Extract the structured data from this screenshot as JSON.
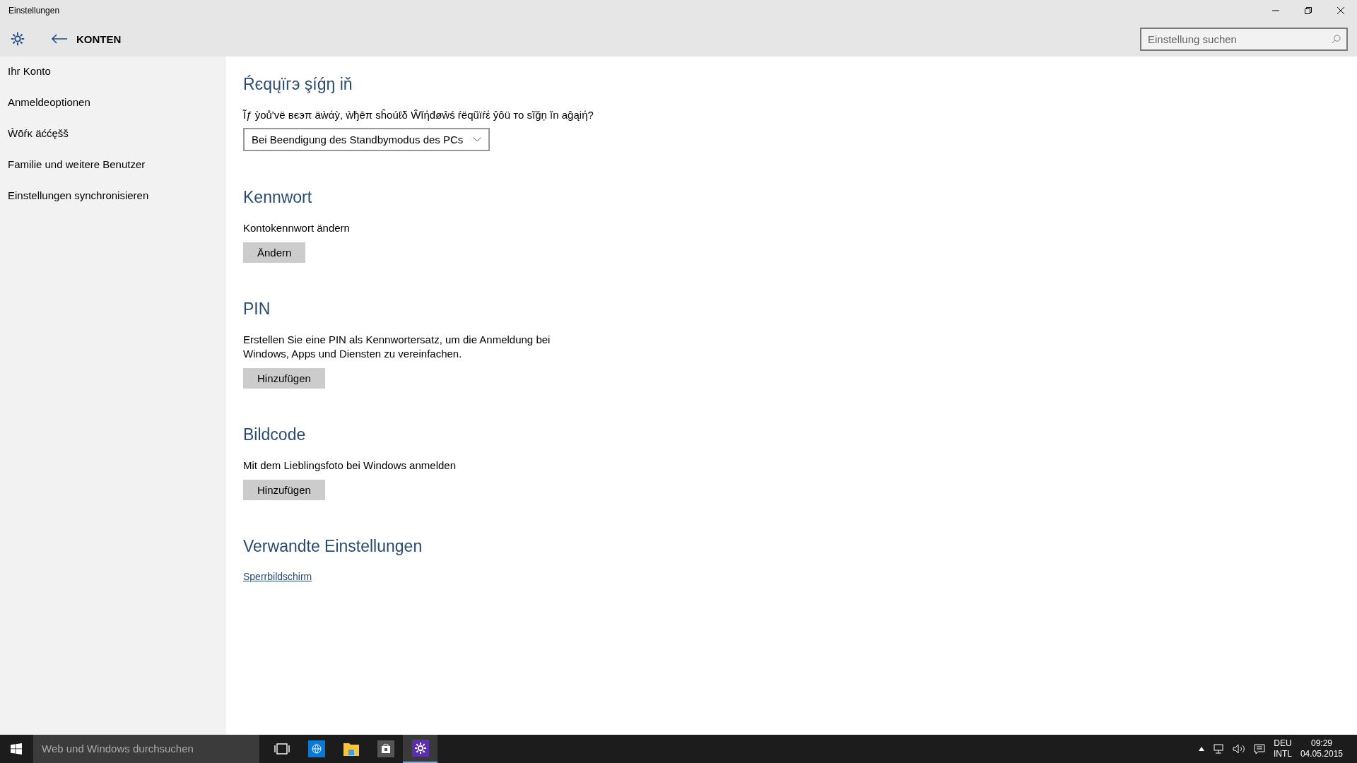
{
  "window": {
    "title": "Einstellungen"
  },
  "header": {
    "title": "KONTEN"
  },
  "search": {
    "placeholder": "Einstellung suchen"
  },
  "sidebar": {
    "items": [
      "Ihr Konto",
      "Anmeldeoptionen",
      "Ẁōŕκ äććęšš",
      "Familie und weitere Benutzer",
      "Einstellungen synchronisieren"
    ]
  },
  "sections": [
    {
      "heading": "Ŕєqųïгэ şíǵŋ iň",
      "kind": "dropdown",
      "text": "Ĩƒ ỳoů'vë вєэπ äẁάỳ, ẁђēπ sĥoúℓδ Ŵĭήđøŵś ŕëqũïŕέ ŷôü тο sĩğņ ĭn aĝąiή?",
      "value": "Bei Beendigung des Standbymodus des PCs"
    },
    {
      "heading": "Kennwort",
      "kind": "button",
      "text": "Kontokennwort ändern",
      "button": "Ändern"
    },
    {
      "heading": "PIN",
      "kind": "button",
      "text": "Erstellen Sie eine PIN als Kennwortersatz, um die Anmeldung bei Windows, Apps und Diensten zu vereinfachen.",
      "button": "Hinzufügen"
    },
    {
      "heading": "Bildcode",
      "kind": "button",
      "text": "Mit dem Lieblingsfoto bei Windows anmelden",
      "button": "Hinzufügen"
    },
    {
      "heading": "Verwandte Einstellungen",
      "kind": "link",
      "link": "Sperrbildschirm"
    }
  ],
  "taskbar": {
    "search_placeholder": "Web und Windows durchsuchen",
    "apps": [
      {
        "kind": "taskview",
        "active": false
      },
      {
        "kind": "browser",
        "active": false
      },
      {
        "kind": "folder",
        "active": false
      },
      {
        "kind": "store",
        "active": false
      },
      {
        "kind": "settings",
        "active": true
      }
    ],
    "language": "DEU",
    "layout": "INTL",
    "time": "09:29",
    "date": "04.05.2015"
  }
}
